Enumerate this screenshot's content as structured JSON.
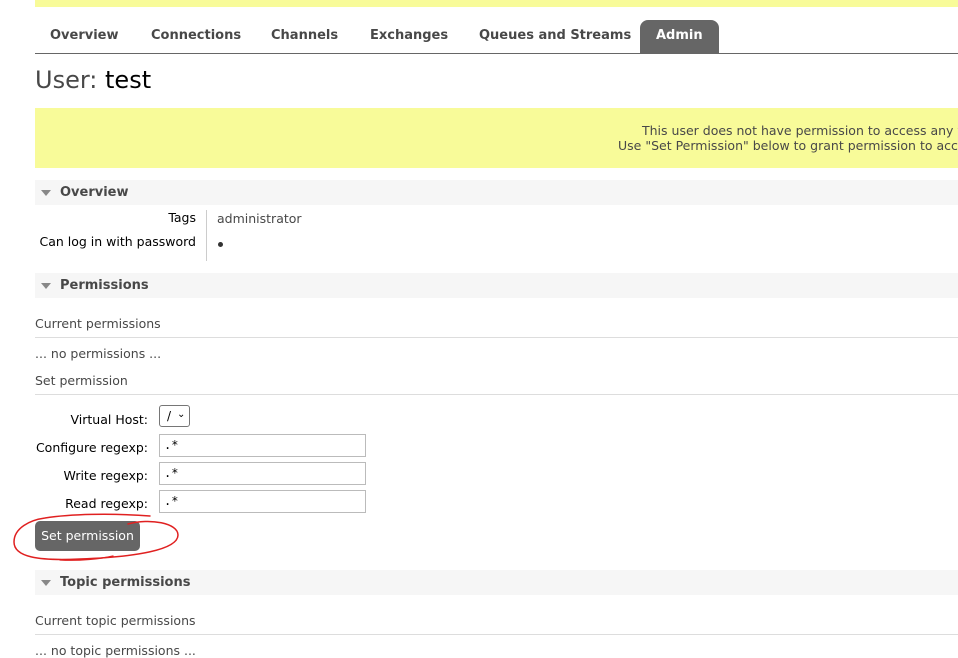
{
  "tabs": [
    {
      "label": "Overview",
      "active": false
    },
    {
      "label": "Connections",
      "active": false
    },
    {
      "label": "Channels",
      "active": false
    },
    {
      "label": "Exchanges",
      "active": false
    },
    {
      "label": "Queues and Streams",
      "active": false
    },
    {
      "label": "Admin",
      "active": true
    }
  ],
  "page": {
    "title_prefix": "User:",
    "username": "test"
  },
  "warning": {
    "line1": "This user does not have permission to access any virtual hosts.",
    "line2": "Use \"Set Permission\" below to grant permission to access virtual hosts."
  },
  "overview": {
    "header": "Overview",
    "tags_label": "Tags",
    "tags_value": "administrator",
    "password_label": "Can log in with password",
    "password_value_icon": "bullet-dot"
  },
  "permissions": {
    "header": "Permissions",
    "current_heading": "Current permissions",
    "none_text": "... no permissions ...",
    "set_heading": "Set permission",
    "vhost_label": "Virtual Host:",
    "vhost_value": "/",
    "configure_label": "Configure regexp:",
    "configure_value": ".*",
    "write_label": "Write regexp:",
    "write_value": ".*",
    "read_label": "Read regexp:",
    "read_value": ".*",
    "button_label": "Set permission"
  },
  "topic_permissions": {
    "header": "Topic permissions",
    "current_heading": "Current topic permissions",
    "none_text": "... no topic permissions ..."
  },
  "colors": {
    "accent": "#666666",
    "warning_bg": "#f8fb99",
    "annotation": "#e02020"
  }
}
